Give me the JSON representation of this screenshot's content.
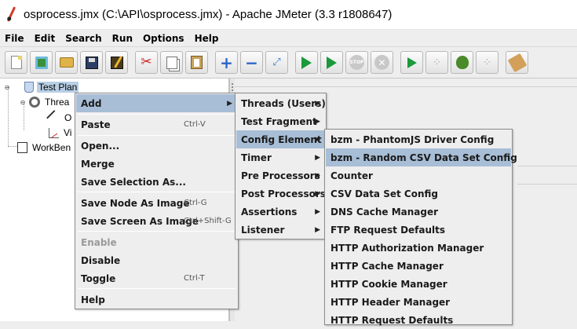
{
  "window": {
    "title": "osprocess.jmx (C:\\API\\osprocess.jmx) - Apache JMeter (3.3 r1808647)"
  },
  "menubar": [
    "File",
    "Edit",
    "Search",
    "Run",
    "Options",
    "Help"
  ],
  "toolbar": {
    "icons": [
      "new-icon",
      "templates-icon",
      "open-icon",
      "save-icon",
      "save-as-icon",
      "cut-icon",
      "copy-icon",
      "paste-icon",
      "expand-icon",
      "collapse-icon",
      "toggle-icon",
      "start-icon",
      "start-no-timers-icon",
      "stop-icon",
      "shutdown-icon",
      "remote-start-icon",
      "remote-stop-icon",
      "function-helper-icon",
      "remote-shutdown-icon",
      "clear-icon"
    ]
  },
  "tree": {
    "nodes": [
      {
        "label": "Test Plan",
        "selected": true
      },
      {
        "label": "Threa"
      },
      {
        "label": "O"
      },
      {
        "label": "Vi"
      },
      {
        "label": "WorkBen"
      }
    ]
  },
  "context_menu": {
    "items": [
      {
        "label": "Add",
        "highlighted": true,
        "submenu": true
      },
      {
        "label": "Paste",
        "shortcut": "Ctrl-V"
      },
      {
        "label": "Open..."
      },
      {
        "label": "Merge"
      },
      {
        "label": "Save Selection As..."
      },
      {
        "label": "Save Node As Image",
        "shortcut": "Ctrl-G"
      },
      {
        "label": "Save Screen As Image",
        "shortcut": "Ctrl+Shift-G"
      },
      {
        "label": "Enable",
        "disabled": true
      },
      {
        "label": "Disable"
      },
      {
        "label": "Toggle",
        "shortcut": "Ctrl-T"
      },
      {
        "label": "Help"
      }
    ]
  },
  "add_menu": {
    "items": [
      {
        "label": "Threads (Users)"
      },
      {
        "label": "Test Fragment"
      },
      {
        "label": "Config Element",
        "highlighted": true
      },
      {
        "label": "Timer"
      },
      {
        "label": "Pre Processors"
      },
      {
        "label": "Post Processors"
      },
      {
        "label": "Assertions"
      },
      {
        "label": "Listener"
      }
    ]
  },
  "config_menu": {
    "items": [
      {
        "label": "bzm - PhantomJS Driver Config"
      },
      {
        "label": "bzm - Random CSV Data Set Config",
        "highlighted": true
      },
      {
        "label": "Counter"
      },
      {
        "label": "CSV Data Set Config"
      },
      {
        "label": "DNS Cache Manager"
      },
      {
        "label": "FTP Request Defaults"
      },
      {
        "label": "HTTP Authorization Manager"
      },
      {
        "label": "HTTP Cache Manager"
      },
      {
        "label": "HTTP Cookie Manager"
      },
      {
        "label": "HTTP Header Manager"
      },
      {
        "label": "HTTP Request Defaults"
      }
    ]
  },
  "colors": {
    "highlight": "#a8bed6",
    "tree_selection": "#b8cfe5",
    "menu_bg": "#eeeeee"
  }
}
